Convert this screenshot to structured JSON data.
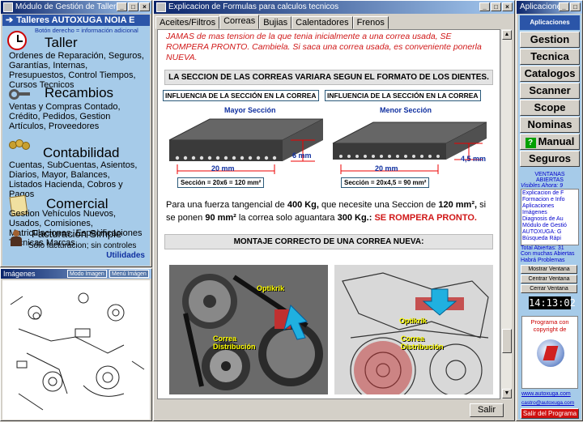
{
  "left_window": {
    "title": "Módulo de Gestión de Talleres",
    "header": "Talleres AUTOXUGA NOIA E",
    "hint": "Botón derecho = información adicional"
  },
  "sections": [
    {
      "title": "Taller",
      "text": "Ordenes de Reparación, Seguros, Garantías, Internas, Presupuestos, Control Tiempos, Cursos Tecnicos"
    },
    {
      "title": "Recambios",
      "text": "Ventas y Compras Contado, Crédito, Pedidos, Gestion Artículos, Proveedores"
    },
    {
      "title": "Contabilidad",
      "text": "Cuentas, SubCuentas, Asientos, Diarios, Mayor, Balances, Listados Hacienda, Cobros y Pagos"
    },
    {
      "title": "Comercial",
      "text": "Gestion Vehículos Nuevos, Usados, Comisiones, Matriculaciones, Especificaciones Tecnicas Marcas"
    },
    {
      "title": "Facturación Simple",
      "text": "Sólo facturacion; sin controles"
    }
  ],
  "utilidades": "Utilidades",
  "images_window": {
    "title": "Imágenes",
    "btn1": "Modo Imagen",
    "btn2": "Menú Imágen"
  },
  "main_window": {
    "title": "Explicacion de Formulas para calculos tecnicos"
  },
  "tabs": [
    "Aceites/Filtros",
    "Correas",
    "Bujias",
    "Calentadores",
    "Frenos"
  ],
  "active_tab": "Correas",
  "content": {
    "warning": "JAMAS de mas tension de la que tenia inicialmente a una correa usada, SE ROMPERA PRONTO. Cambiela. Si saca una correa usada, es conveniente ponerla NUEVA.",
    "section1": "LA SECCION DE LAS CORREAS VARIARA SEGUN EL FORMATO DE LOS DIENTES.",
    "fig_left": {
      "title": "INFLUENCIA DE LA SECCIÓN EN LA CORREA",
      "sub": "Mayor Sección",
      "width": "20 mm",
      "height": "6 mm",
      "formula": "Sección = 20x6 = 120 mm²"
    },
    "fig_right": {
      "title": "INFLUENCIA DE LA SECCIÓN EN LA CORREA",
      "sub": "Menor Sección",
      "width": "20 mm",
      "height": "4,5 mm",
      "formula": "Sección = 20x4,5 = 90 mm²"
    },
    "para_a": "Para una fuerza tangencial de ",
    "para_b": "400 Kg,",
    "para_c": " que necesite una Seccion de ",
    "para_d": "120 mm²,",
    "para_e": " si se ponen ",
    "para_f": "90 mm²",
    "para_g": " la correa solo aguantara ",
    "para_h": "300 Kg.:",
    "para_i": " SE ROMPERA PRONTO.",
    "section2": "MONTAJE CORRECTO DE UNA CORREA NUEVA:",
    "photo_label1": "Optikrik",
    "photo_label2": "Correa Distribución"
  },
  "salir": "Salir",
  "right_window": {
    "title": "Aplicaciones",
    "header": "Aplicaciones"
  },
  "nav": [
    "Gestion",
    "Tecnica",
    "Catalogos",
    "Scanner",
    "Scope",
    "Nominas",
    "Manual",
    "Seguros"
  ],
  "ventanas": {
    "title": "VENTANAS ABIERTAS",
    "visibles": "Visibles Ahora: 9",
    "items": [
      "Explicacion de F",
      "Formacion e Info",
      "Aplicaciones",
      "Imágenes",
      "Diagnosis de Au",
      "Módulo de Gestió",
      "AUTOXUGA: G",
      "Búsqueda Rápi"
    ],
    "total": "Total Abiertas: 31",
    "note": "Con muchas Abiertas Habrá Problemas"
  },
  "win_buttons": [
    "Mostrar Ventana",
    "Centrar Ventana",
    "Cerrar Ventana"
  ],
  "clock": "14:13:02",
  "copyright": "Programa con copyright de",
  "web": "www.autoxuga.com",
  "email": "castro@autoxuga.com",
  "exit": "Salir del Programa"
}
